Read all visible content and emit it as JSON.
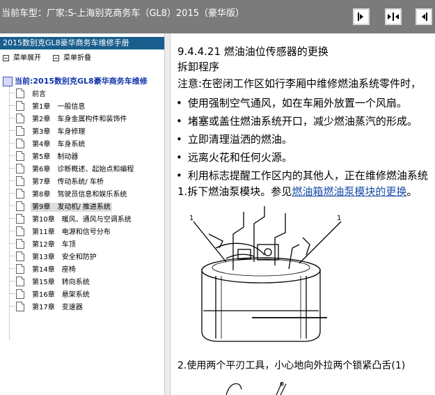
{
  "header": {
    "title": "当前车型：厂家:S-上海别克商务车（GL8）2015（豪华版）",
    "buttons": [
      "next-page-icon",
      "expand-icon",
      "prev-page-icon"
    ]
  },
  "sidebar": {
    "manual_title": "2015数别克GL8豪华商务车维修手册",
    "expand_label": "菜单展开",
    "collapse_label": "菜单折叠",
    "current_label": "当前:2015数别克GL8豪华商务车维修",
    "chapters": [
      {
        "label": "前言"
      },
      {
        "label": "第1章　一般信息"
      },
      {
        "label": "第2章　车身金属构件和装饰件"
      },
      {
        "label": "第3章　车身修理"
      },
      {
        "label": "第4章　车身系统"
      },
      {
        "label": "第5章　制动器"
      },
      {
        "label": "第6章　诊断概述、起始点和编程"
      },
      {
        "label": "第7章　传动系统/ 车桥"
      },
      {
        "label": "第8章　驾驶员信息和娱乐系统"
      },
      {
        "label": "第9章　发动机/ 推进系统",
        "selected": true
      },
      {
        "label": "第10章　暖风、通风与空调系统"
      },
      {
        "label": "第11章　电源和信号分布"
      },
      {
        "label": "第12章　车顶"
      },
      {
        "label": "第13章　安全和防护"
      },
      {
        "label": "第14章　座椅"
      },
      {
        "label": "第15章　转向系统"
      },
      {
        "label": "第16章　悬架系统"
      },
      {
        "label": "第17章　变速器"
      }
    ]
  },
  "content": {
    "section_title": "9.4.4.21 燃油油位传感器的更换",
    "subtitle": "拆卸程序",
    "caution": "注意:在密闭工作区如行李厢中维修燃油系统零件时，",
    "bullets": [
      "使用强制空气通风，如在车厢外放置一个风扇。",
      "堵塞或盖住燃油系统开口，减少燃油蒸汽的形成。",
      "立即清理溢洒的燃油。",
      "远离火花和任何火源。",
      "利用标志提醒工作区内的其他人，正在维修燃油系统"
    ],
    "step1_prefix": "1.拆下燃油泵模块。参见",
    "step1_link": "燃油箱燃油泵模块的更换",
    "step1_suffix": "。",
    "figure1_callouts": [
      "1",
      "1"
    ],
    "step2": "2.使用两个平刃工具，小心地向外拉两个锁紧凸舌(1)"
  }
}
